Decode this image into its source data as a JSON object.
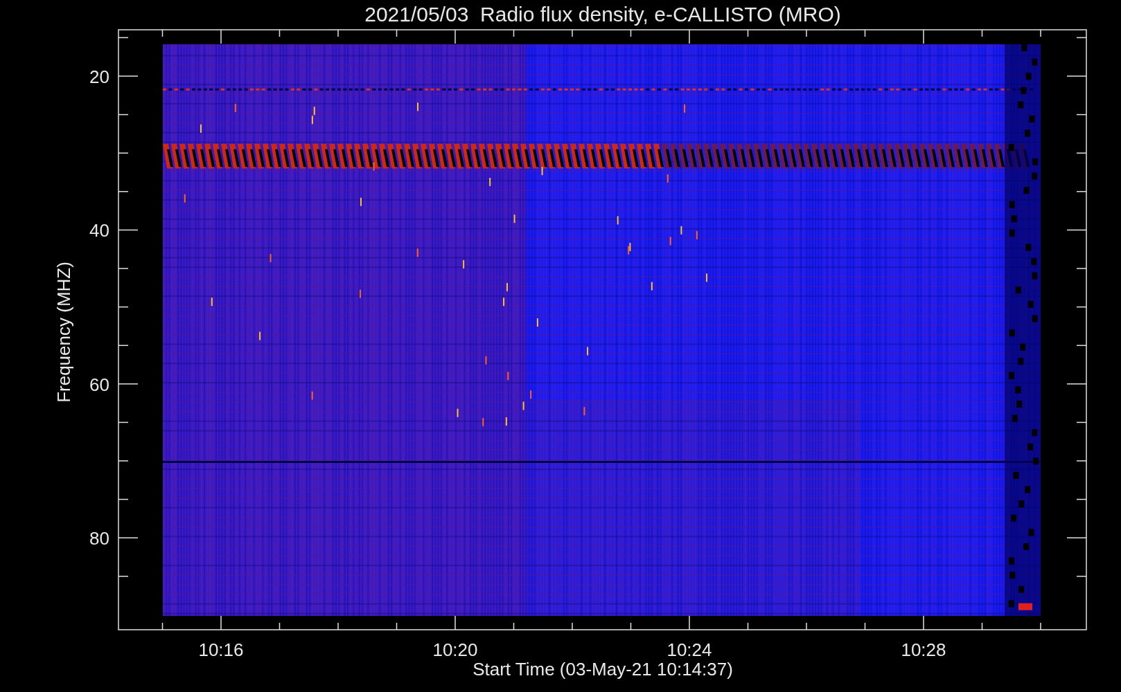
{
  "title": "2021/05/03  Radio flux density, e-CALLISTO (MRO)",
  "y_axis": {
    "label": "Frequency (MHZ)",
    "ticks": [
      "20",
      "40",
      "60",
      "80"
    ]
  },
  "x_axis": {
    "label": "Start Time (03-May-21 10:14:37)",
    "ticks": [
      "10:16",
      "10:20",
      "10:24",
      "10:28"
    ]
  }
}
